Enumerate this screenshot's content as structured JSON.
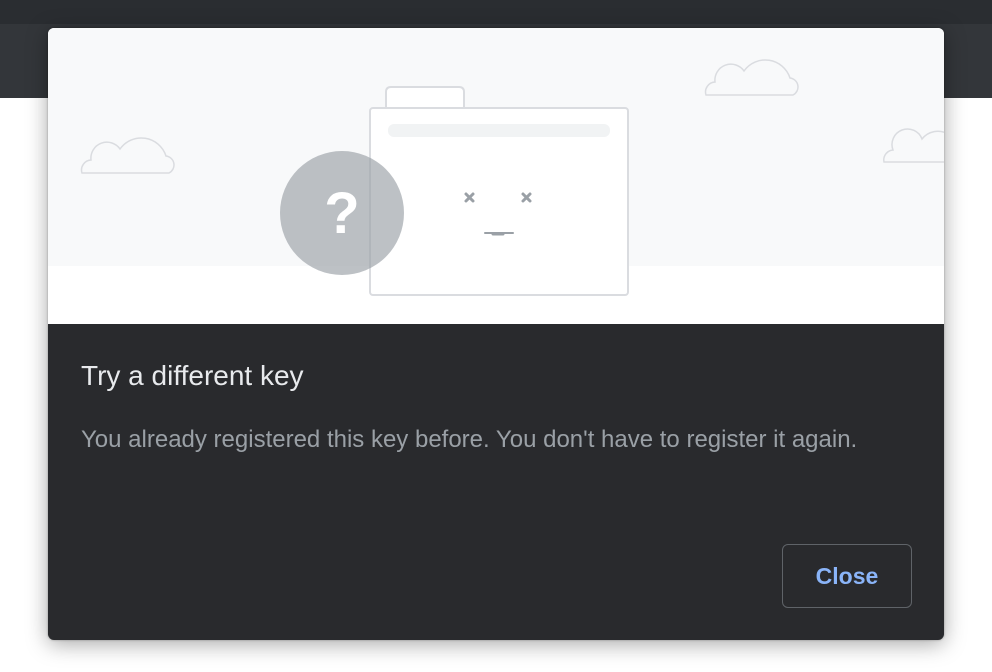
{
  "dialog": {
    "title": "Try a different key",
    "message": "You already registered this key before. You don't have to register it again.",
    "close_label": "Close"
  },
  "illustration": {
    "badge_glyph": "?",
    "icons": [
      "cloud-icon",
      "folder-icon",
      "question-mark-icon",
      "sad-face-icon"
    ]
  },
  "colors": {
    "dialog_background": "#292a2d",
    "title": "#e8eaed",
    "message": "#9aa0a6",
    "accent": "#8ab4f8",
    "button_border": "#5f6368",
    "illustration_sky": "#f8f9fa",
    "badge": "#bdc1c6"
  }
}
